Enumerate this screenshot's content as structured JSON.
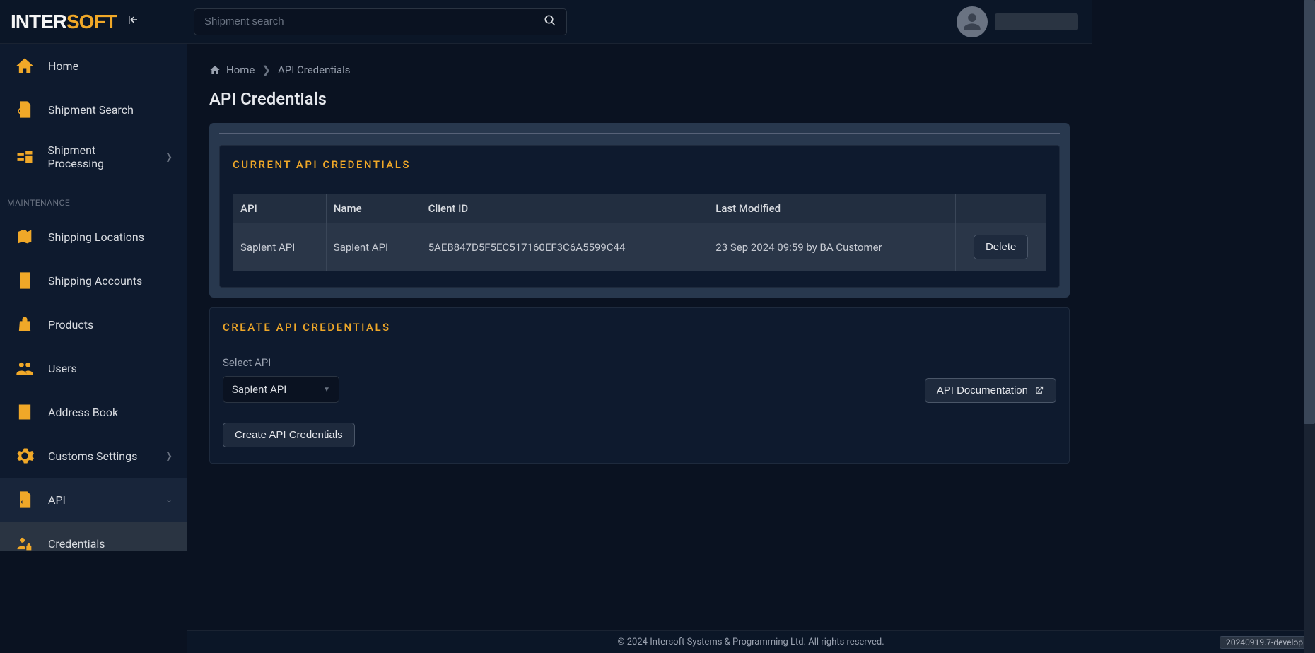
{
  "brand": {
    "inter": "INTER",
    "soft": "SOFT"
  },
  "header": {
    "search_placeholder": "Shipment search"
  },
  "sidebar": {
    "items": [
      {
        "label": "Home",
        "icon": "home-icon"
      },
      {
        "label": "Shipment Search",
        "icon": "search-doc-icon"
      },
      {
        "label": "Shipment Processing",
        "icon": "processing-icon",
        "has_children": true
      }
    ],
    "section_label": "MAINTENANCE",
    "maint_items": [
      {
        "label": "Shipping Locations",
        "icon": "map-pin-icon"
      },
      {
        "label": "Shipping Accounts",
        "icon": "clipboard-icon"
      },
      {
        "label": "Products",
        "icon": "bag-icon"
      },
      {
        "label": "Users",
        "icon": "users-icon"
      },
      {
        "label": "Address Book",
        "icon": "address-book-icon"
      },
      {
        "label": "Customs Settings",
        "icon": "gear-icon",
        "has_children": true
      },
      {
        "label": "API",
        "icon": "code-doc-icon",
        "has_children": true,
        "expanded": true,
        "active": true
      },
      {
        "label": "Credentials",
        "icon": "lock-user-icon",
        "sub": true,
        "active": true
      }
    ]
  },
  "breadcrumb": {
    "home": "Home",
    "current": "API Credentials"
  },
  "page_title": "API Credentials",
  "current_panel": {
    "title": "CURRENT API CREDENTIALS",
    "columns": [
      "API",
      "Name",
      "Client ID",
      "Last Modified",
      ""
    ],
    "rows": [
      {
        "api": "Sapient API",
        "name": "Sapient API",
        "client_id": "5AEB847D5F5EC517160EF3C6A5599C44",
        "last_modified": "23 Sep 2024 09:59 by BA Customer",
        "action_label": "Delete"
      }
    ]
  },
  "create_panel": {
    "title": "CREATE API CREDENTIALS",
    "select_label": "Select API",
    "select_value": "Sapient API",
    "doc_button": "API Documentation",
    "create_button": "Create API Credentials"
  },
  "footer": {
    "copyright": "© 2024 Intersoft Systems & Programming Ltd. All rights reserved.",
    "version": "20240919.7-develop"
  }
}
